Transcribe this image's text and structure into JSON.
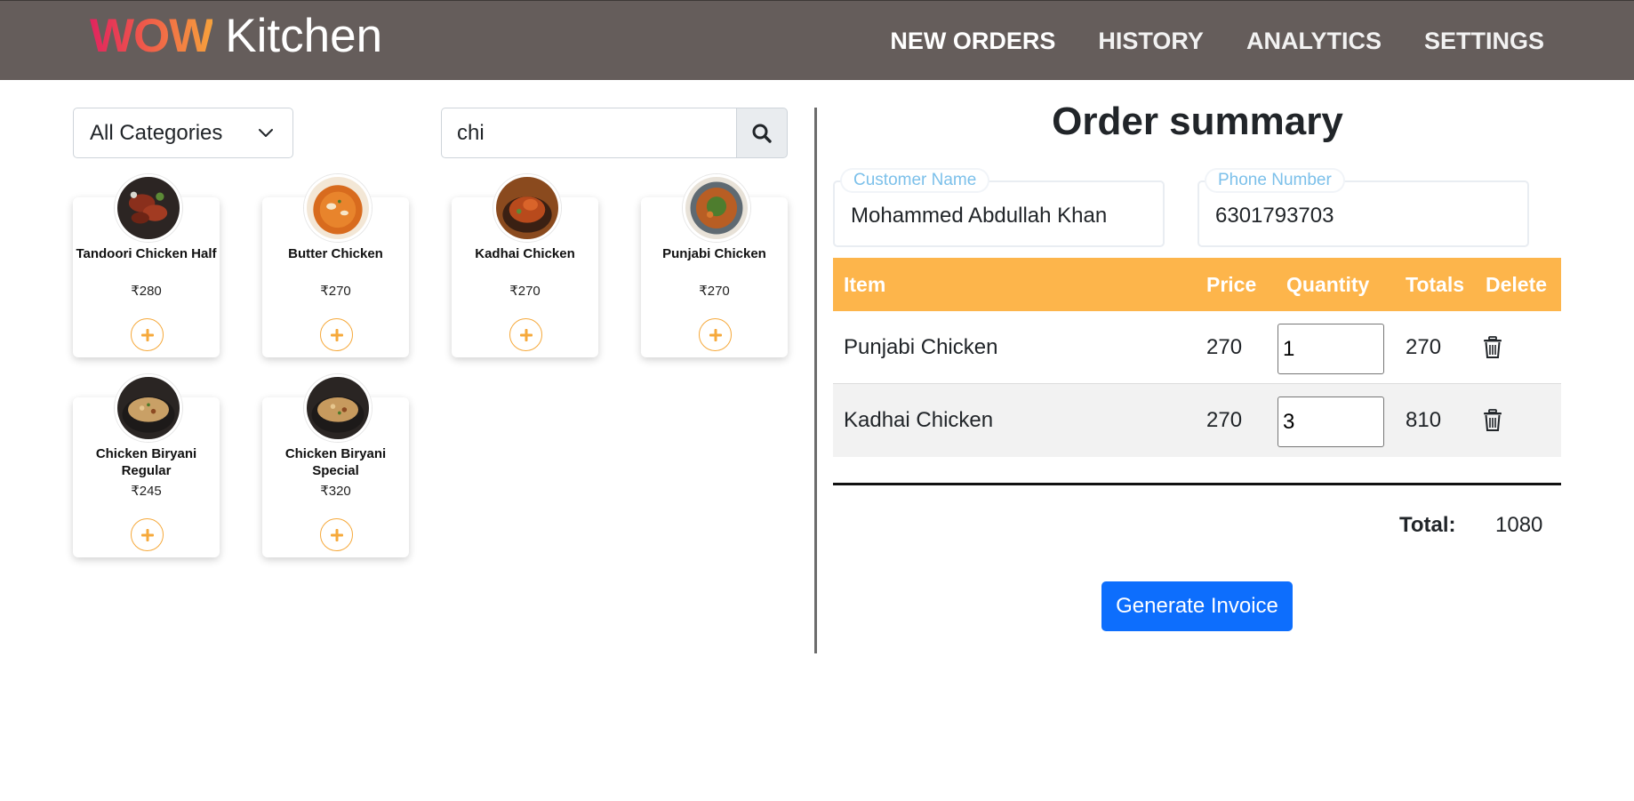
{
  "brand": {
    "wow": "WOW",
    "name": "Kitchen"
  },
  "nav": [
    {
      "label": "NEW ORDERS",
      "active": true
    },
    {
      "label": "HISTORY",
      "active": false
    },
    {
      "label": "ANALYTICS",
      "active": false
    },
    {
      "label": "SETTINGS",
      "active": false
    }
  ],
  "filters": {
    "category": "All Categories",
    "search_value": "chi",
    "search_icon": "search-icon"
  },
  "menu_items": [
    {
      "name": "Tandoori Chicken Half",
      "price": "₹280",
      "image": "tandoori-chicken-image"
    },
    {
      "name": "Butter Chicken",
      "price": "₹270",
      "image": "butter-chicken-image"
    },
    {
      "name": "Kadhai Chicken",
      "price": "₹270",
      "image": "kadhai-chicken-image"
    },
    {
      "name": "Punjabi Chicken",
      "price": "₹270",
      "image": "punjabi-chicken-image"
    },
    {
      "name": "Chicken Biryani Regular",
      "price": "₹245",
      "image": "chicken-biryani-image"
    },
    {
      "name": "Chicken Biryani Special",
      "price": "₹320",
      "image": "chicken-biryani-special-image"
    }
  ],
  "order": {
    "title": "Order summary",
    "customer_label": "Customer Name",
    "customer_value": "Mohammed Abdullah Khan",
    "phone_label": "Phone Number",
    "phone_value": "6301793703",
    "columns": [
      "Item",
      "Price",
      "Quantity",
      "Totals",
      "Delete"
    ],
    "rows": [
      {
        "item": "Punjabi Chicken",
        "price": "270",
        "quantity": "1",
        "total": "270"
      },
      {
        "item": "Kadhai Chicken",
        "price": "270",
        "quantity": "3",
        "total": "810"
      }
    ],
    "total_label": "Total:",
    "total_value": "1080",
    "invoice_button": "Generate Invoice"
  },
  "colors": {
    "navbar": "#655d5b",
    "accent_orange": "#fdb54b",
    "primary_blue": "#0d6efd",
    "label_blue": "#7cc0ea"
  }
}
